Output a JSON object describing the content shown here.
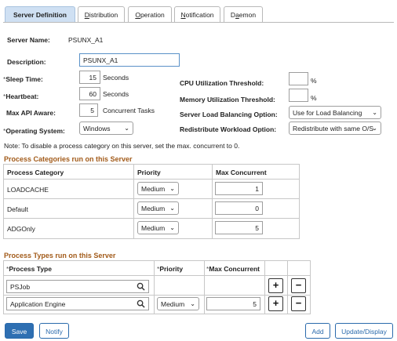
{
  "tabs": [
    {
      "label": "Server Definition",
      "underline": ""
    },
    {
      "label": "Distribution",
      "underline": "D"
    },
    {
      "label": "Operation",
      "underline": "O"
    },
    {
      "label": "Notification",
      "underline": "N"
    },
    {
      "label": "Daemon",
      "underline": "a"
    }
  ],
  "server": {
    "name_label": "Server Name:",
    "name_value": "PSUNX_A1",
    "description_label": "Description:",
    "description_value": "PSUNX_A1",
    "sleep_label": "Sleep Time:",
    "sleep_value": "15",
    "sleep_unit": "Seconds",
    "heartbeat_label": "Heartbeat:",
    "heartbeat_value": "60",
    "heartbeat_unit": "Seconds",
    "maxapi_label": "Max API Aware:",
    "maxapi_value": "5",
    "maxapi_unit": "Concurrent Tasks",
    "os_label": "Operating System:",
    "os_value": "Windows",
    "cpu_label": "CPU Utilization Threshold:",
    "cpu_value": "",
    "cpu_unit": "%",
    "mem_label": "Memory Utilization Threshold:",
    "mem_value": "",
    "mem_unit": "%",
    "lb_label": "Server Load Balancing Option:",
    "lb_value": "Use for Load Balancing",
    "redis_label": "Redistribute Workload Option:",
    "redis_value": "Redistribute with same O/S",
    "required_mark": "*",
    "note": "Note: To disable a process category on this server, set the max. concurrent to 0."
  },
  "categories": {
    "title": "Process Categories run on this Server",
    "headers": [
      "Process Category",
      "Priority",
      "Max Concurrent"
    ],
    "rows": [
      {
        "category": "LOADCACHE",
        "priority": "Medium",
        "max": "1"
      },
      {
        "category": "Default",
        "priority": "Medium",
        "max": "0"
      },
      {
        "category": "ADGOnly",
        "priority": "Medium",
        "max": "5"
      }
    ]
  },
  "types": {
    "title": "Process Types run on this Server",
    "headers": [
      "Process Type",
      "Priority",
      "Max Concurrent"
    ],
    "rows": [
      {
        "type": "PSJob",
        "priority": "",
        "max": ""
      },
      {
        "type": "Application Engine",
        "priority": "Medium",
        "max": "5"
      }
    ],
    "add_symbol": "+",
    "remove_symbol": "−"
  },
  "footer": {
    "save": "Save",
    "notify": "Notify",
    "add": "Add",
    "update": "Update/Display"
  },
  "colors": {
    "accent": "#2e6fb2",
    "section_title": "#a25b1a",
    "active_tab": "#cfe0f3"
  }
}
